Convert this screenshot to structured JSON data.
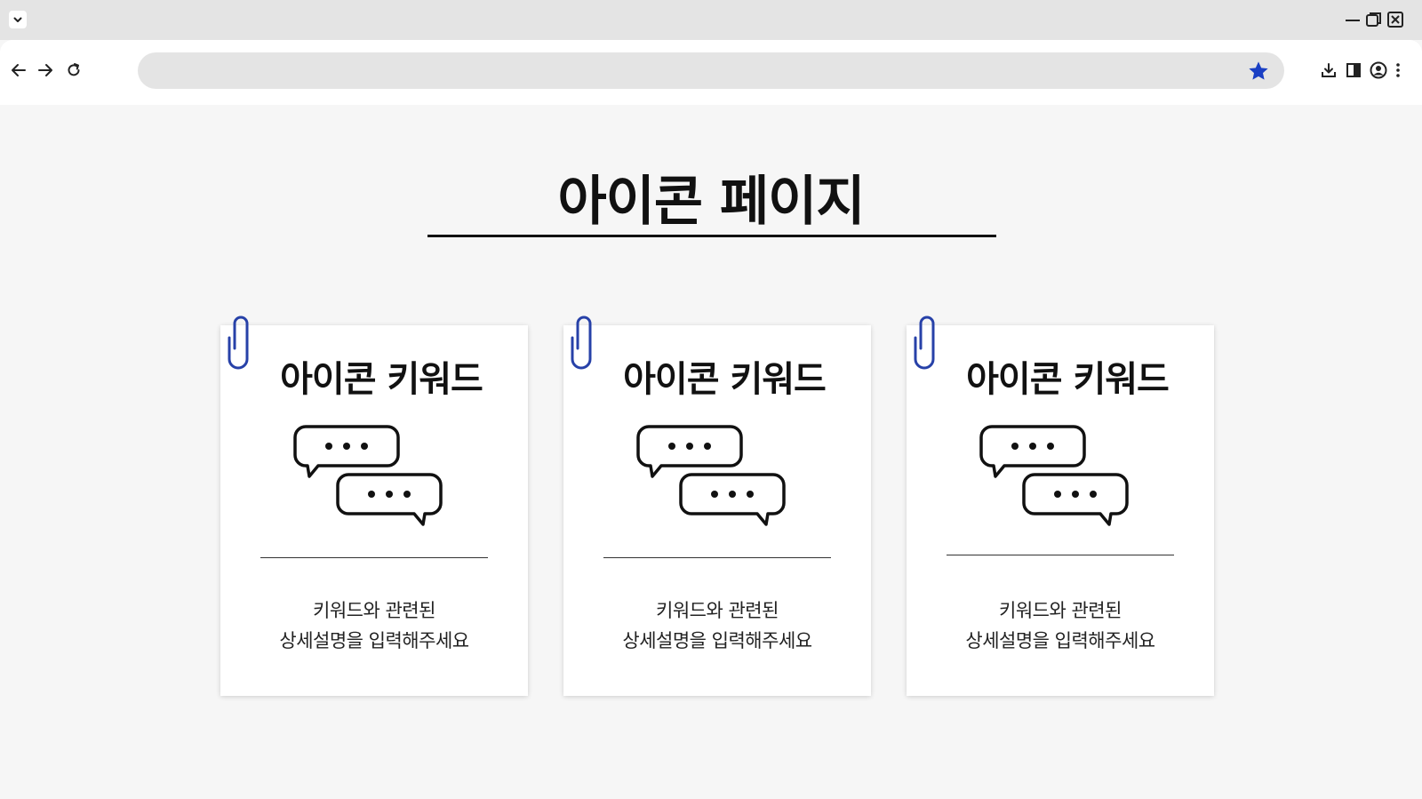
{
  "browser": {
    "tab_menu_icon": "chevron-down-icon",
    "window_controls": [
      "minimize-icon",
      "restore-icon",
      "close-icon"
    ],
    "nav": [
      "back-arrow-icon",
      "forward-arrow-icon",
      "reload-icon"
    ],
    "address_value": "",
    "bookmark_icon": "star-icon",
    "bookmark_color": "#1a3fc4",
    "toolbar_right": [
      "download-icon",
      "side-panel-icon",
      "profile-icon",
      "more-vert-icon"
    ]
  },
  "page": {
    "title": "아이콘 페이지",
    "accent_color": "#2741a8",
    "cards": [
      {
        "title": "아이콘 키워드",
        "icon": "chat-bubbles-icon",
        "desc_line1": "키워드와 관련된",
        "desc_line2": "상세설명을 입력해주세요"
      },
      {
        "title": "아이콘 키워드",
        "icon": "chat-bubbles-icon",
        "desc_line1": "키워드와 관련된",
        "desc_line2": "상세설명을 입력해주세요"
      },
      {
        "title": "아이콘 키워드",
        "icon": "chat-bubbles-icon",
        "desc_line1": "키워드와 관련된",
        "desc_line2": "상세설명을 입력해주세요"
      }
    ]
  }
}
